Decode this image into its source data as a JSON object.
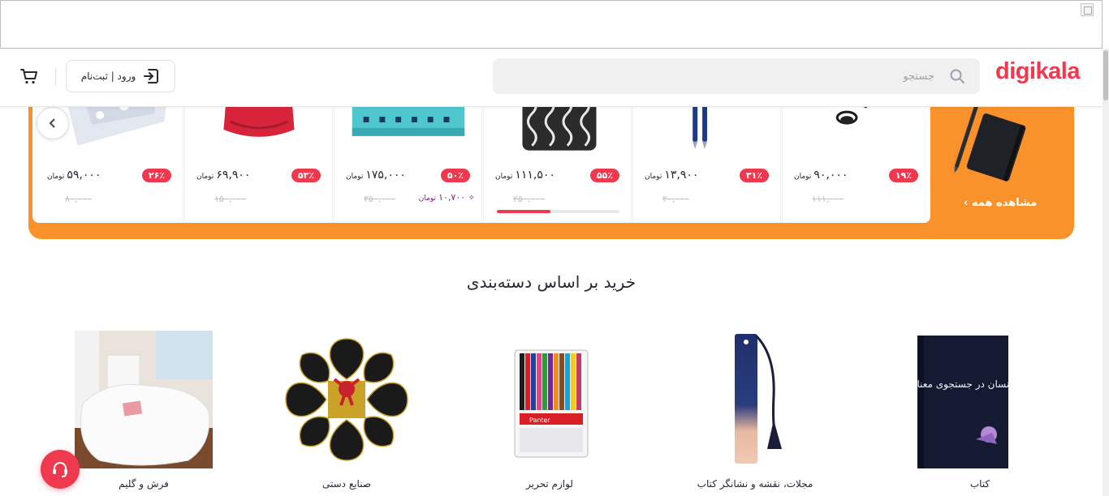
{
  "header": {
    "logo": "digikala",
    "search_placeholder": "جستجو",
    "login_label": "ورود | ثبت‌نام"
  },
  "offers": {
    "see_all": "مشاهده همه ›",
    "currency": "تومان",
    "cards": [
      {
        "discount": "۱۹٪",
        "price": "۹۰,۰۰۰",
        "old_price": "۱۱۱,۰۰۰",
        "image": "earphones"
      },
      {
        "discount": "۳۱٪",
        "price": "۱۳,۹۰۰",
        "old_price": "۲۰,۰۰۰",
        "image": "pens"
      },
      {
        "discount": "۵۵٪",
        "price": "۱۱۱,۵۰۰",
        "old_price": "۲۵۰,۰۰۰",
        "image": "rug",
        "sold_fraction": 0.44
      },
      {
        "discount": "۵۰٪",
        "price": "۱۷۵,۰۰۰",
        "old_price": "۳۵۰,۰۰۰",
        "special_price": "۱۰,۷۰۰",
        "image": "box"
      },
      {
        "discount": "۵۳٪",
        "price": "۶۹,۹۰۰",
        "old_price": "۱۵۰,۰۰۰",
        "image": "bag"
      },
      {
        "discount": "۲۶٪",
        "price": "۵۹,۰۰۰",
        "old_price": "۸۰,۰۰۰",
        "image": "stickers"
      }
    ]
  },
  "categories": {
    "title": "خرید بر اساس دسته‌بندی",
    "items": [
      {
        "label": "کتاب",
        "image": "book",
        "book_title": "انسان در جستجوی معنا"
      },
      {
        "label": "مجلات، نقشه و نشانگر کتاب",
        "image": "bookmark"
      },
      {
        "label": "لوازم تحریر",
        "image": "markers",
        "brand": "Panter"
      },
      {
        "label": "صنایع دستی",
        "image": "gift-box"
      },
      {
        "label": "فرش و گلیم",
        "image": "fur-rug"
      }
    ]
  },
  "colors": {
    "brand": "#ef394e",
    "offer_bg": "#f9922a"
  }
}
